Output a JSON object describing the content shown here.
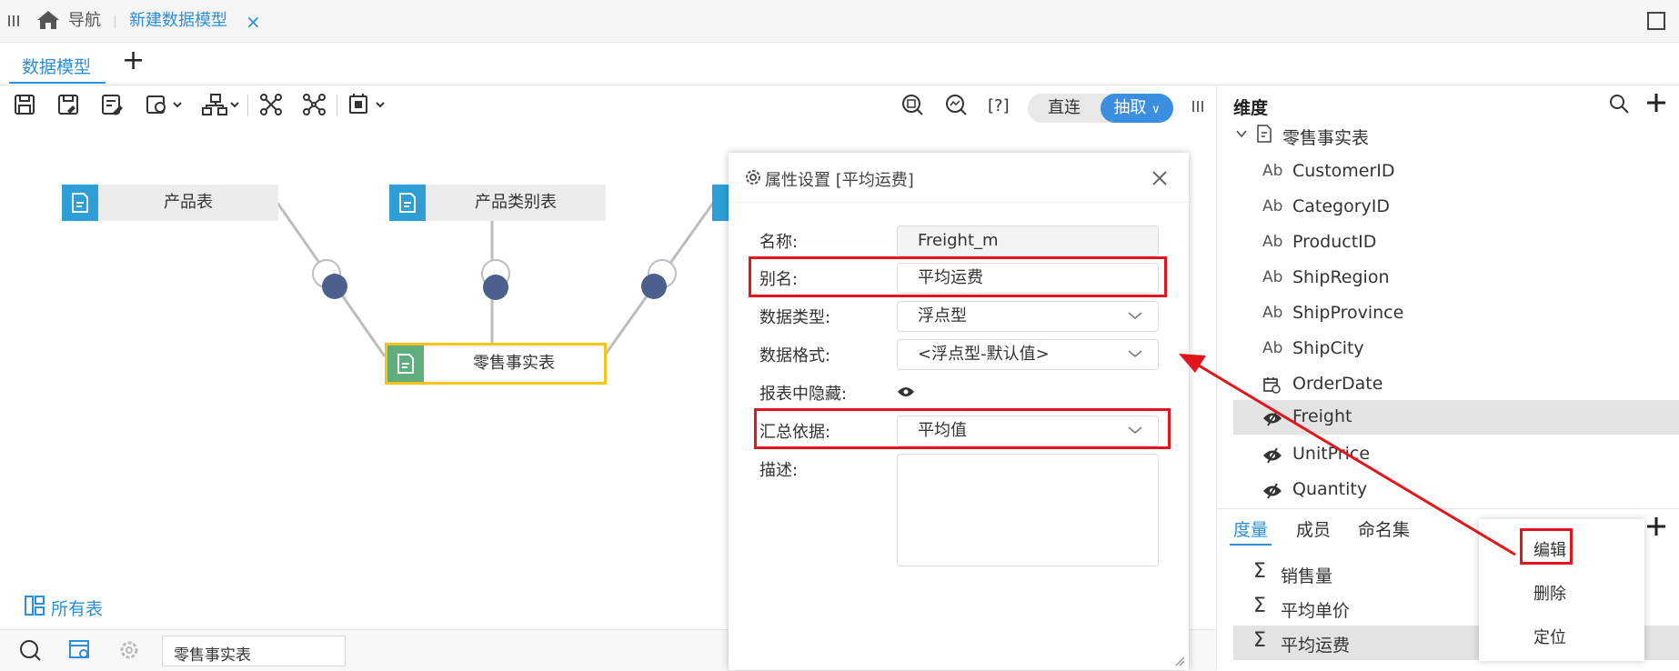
{
  "nav": {
    "home_label": "导航",
    "tab_title": "新建数据模型",
    "close_glyph": "×"
  },
  "tabs": {
    "active": "数据模型",
    "add_glyph": "+"
  },
  "toolbar": {
    "direct_label": "直连",
    "extract_label": "抽取",
    "help_label": "[?]"
  },
  "canvas": {
    "tables": [
      "产品表",
      "产品类别表"
    ],
    "fact_table": "零售事实表",
    "all_tables_label": "所有表"
  },
  "dialog": {
    "title": "属性设置 [平均运费]",
    "fields": {
      "name_label": "名称:",
      "name_value": "Freight_m",
      "alias_label": "别名:",
      "alias_value": "平均运费",
      "type_label": "数据类型:",
      "type_value": "浮点型",
      "format_label": "数据格式:",
      "format_value": "<浮点型-默认值>",
      "hidden_label": "报表中隐藏:",
      "agg_label": "汇总依据:",
      "agg_value": "平均值",
      "desc_label": "描述:"
    }
  },
  "right_panel": {
    "dim_header": "维度",
    "tree_root": "零售事实表",
    "dims": [
      {
        "kind": "text",
        "label": "CustomerID"
      },
      {
        "kind": "text",
        "label": "CategoryID"
      },
      {
        "kind": "text",
        "label": "ProductID"
      },
      {
        "kind": "text",
        "label": "ShipRegion"
      },
      {
        "kind": "text",
        "label": "ShipProvince"
      },
      {
        "kind": "text",
        "label": "ShipCity"
      },
      {
        "kind": "date",
        "label": "OrderDate"
      },
      {
        "kind": "hidden",
        "label": "Freight"
      },
      {
        "kind": "hidden",
        "label": "UnitPrice"
      },
      {
        "kind": "hidden",
        "label": "Quantity"
      }
    ],
    "text_badge": "Ab",
    "measure_tabs": [
      "度量",
      "成员",
      "命名集"
    ],
    "measures": [
      "销售量",
      "平均单价",
      "平均运费"
    ],
    "sigma": "Σ",
    "context_menu": [
      "编辑",
      "删除",
      "定位"
    ]
  },
  "bottom": {
    "search_value": "零售事实表"
  },
  "colors": {
    "accent": "#3c8fe0",
    "highlight_red": "#e3141b",
    "fact_border": "#f5c518"
  }
}
